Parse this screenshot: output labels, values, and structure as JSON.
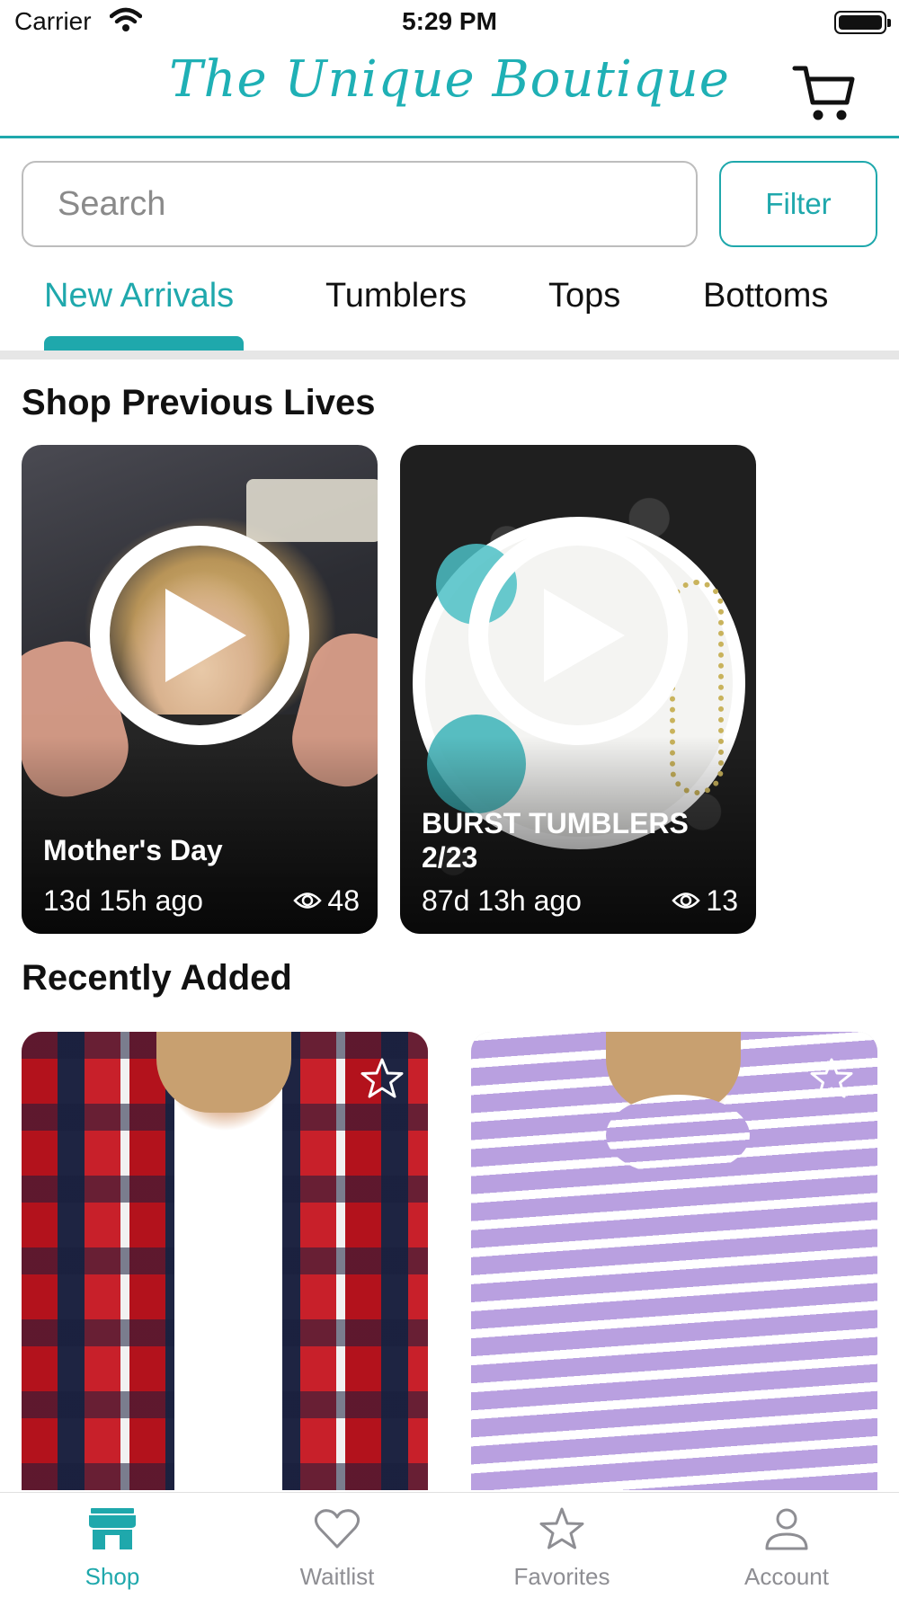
{
  "status_bar": {
    "carrier": "Carrier",
    "time": "5:29 PM"
  },
  "header": {
    "logo_text": "The Unique Boutique",
    "cart_icon": "cart-icon"
  },
  "search": {
    "placeholder": "Search",
    "value": ""
  },
  "filter_label": "Filter",
  "category_tabs": [
    {
      "label": "New Arrivals",
      "active": true
    },
    {
      "label": "Tumblers",
      "active": false
    },
    {
      "label": "Tops",
      "active": false
    },
    {
      "label": "Bottoms",
      "active": false
    }
  ],
  "previous_lives": {
    "title": "Shop Previous Lives",
    "items": [
      {
        "title": "Mother's Day",
        "ago": "13d 15h ago",
        "views": "48"
      },
      {
        "title": "BURST TUMBLERS 2/23",
        "ago": "87d 13h ago",
        "views": "13"
      }
    ]
  },
  "recently_added": {
    "title": "Recently Added",
    "items": [
      {
        "name": "red-plaid-shacket",
        "favorite": false
      },
      {
        "name": "lavender-striped-cowl-neck",
        "favorite": false
      }
    ]
  },
  "tabbar": {
    "items": [
      {
        "label": "Shop",
        "icon": "storefront-icon",
        "active": true
      },
      {
        "label": "Waitlist",
        "icon": "heart-icon",
        "active": false
      },
      {
        "label": "Favorites",
        "icon": "star-icon",
        "active": false
      },
      {
        "label": "Account",
        "icon": "person-icon",
        "active": false
      }
    ]
  },
  "colors": {
    "accent": "#1fa8ac",
    "inactive": "#8e8e93"
  }
}
